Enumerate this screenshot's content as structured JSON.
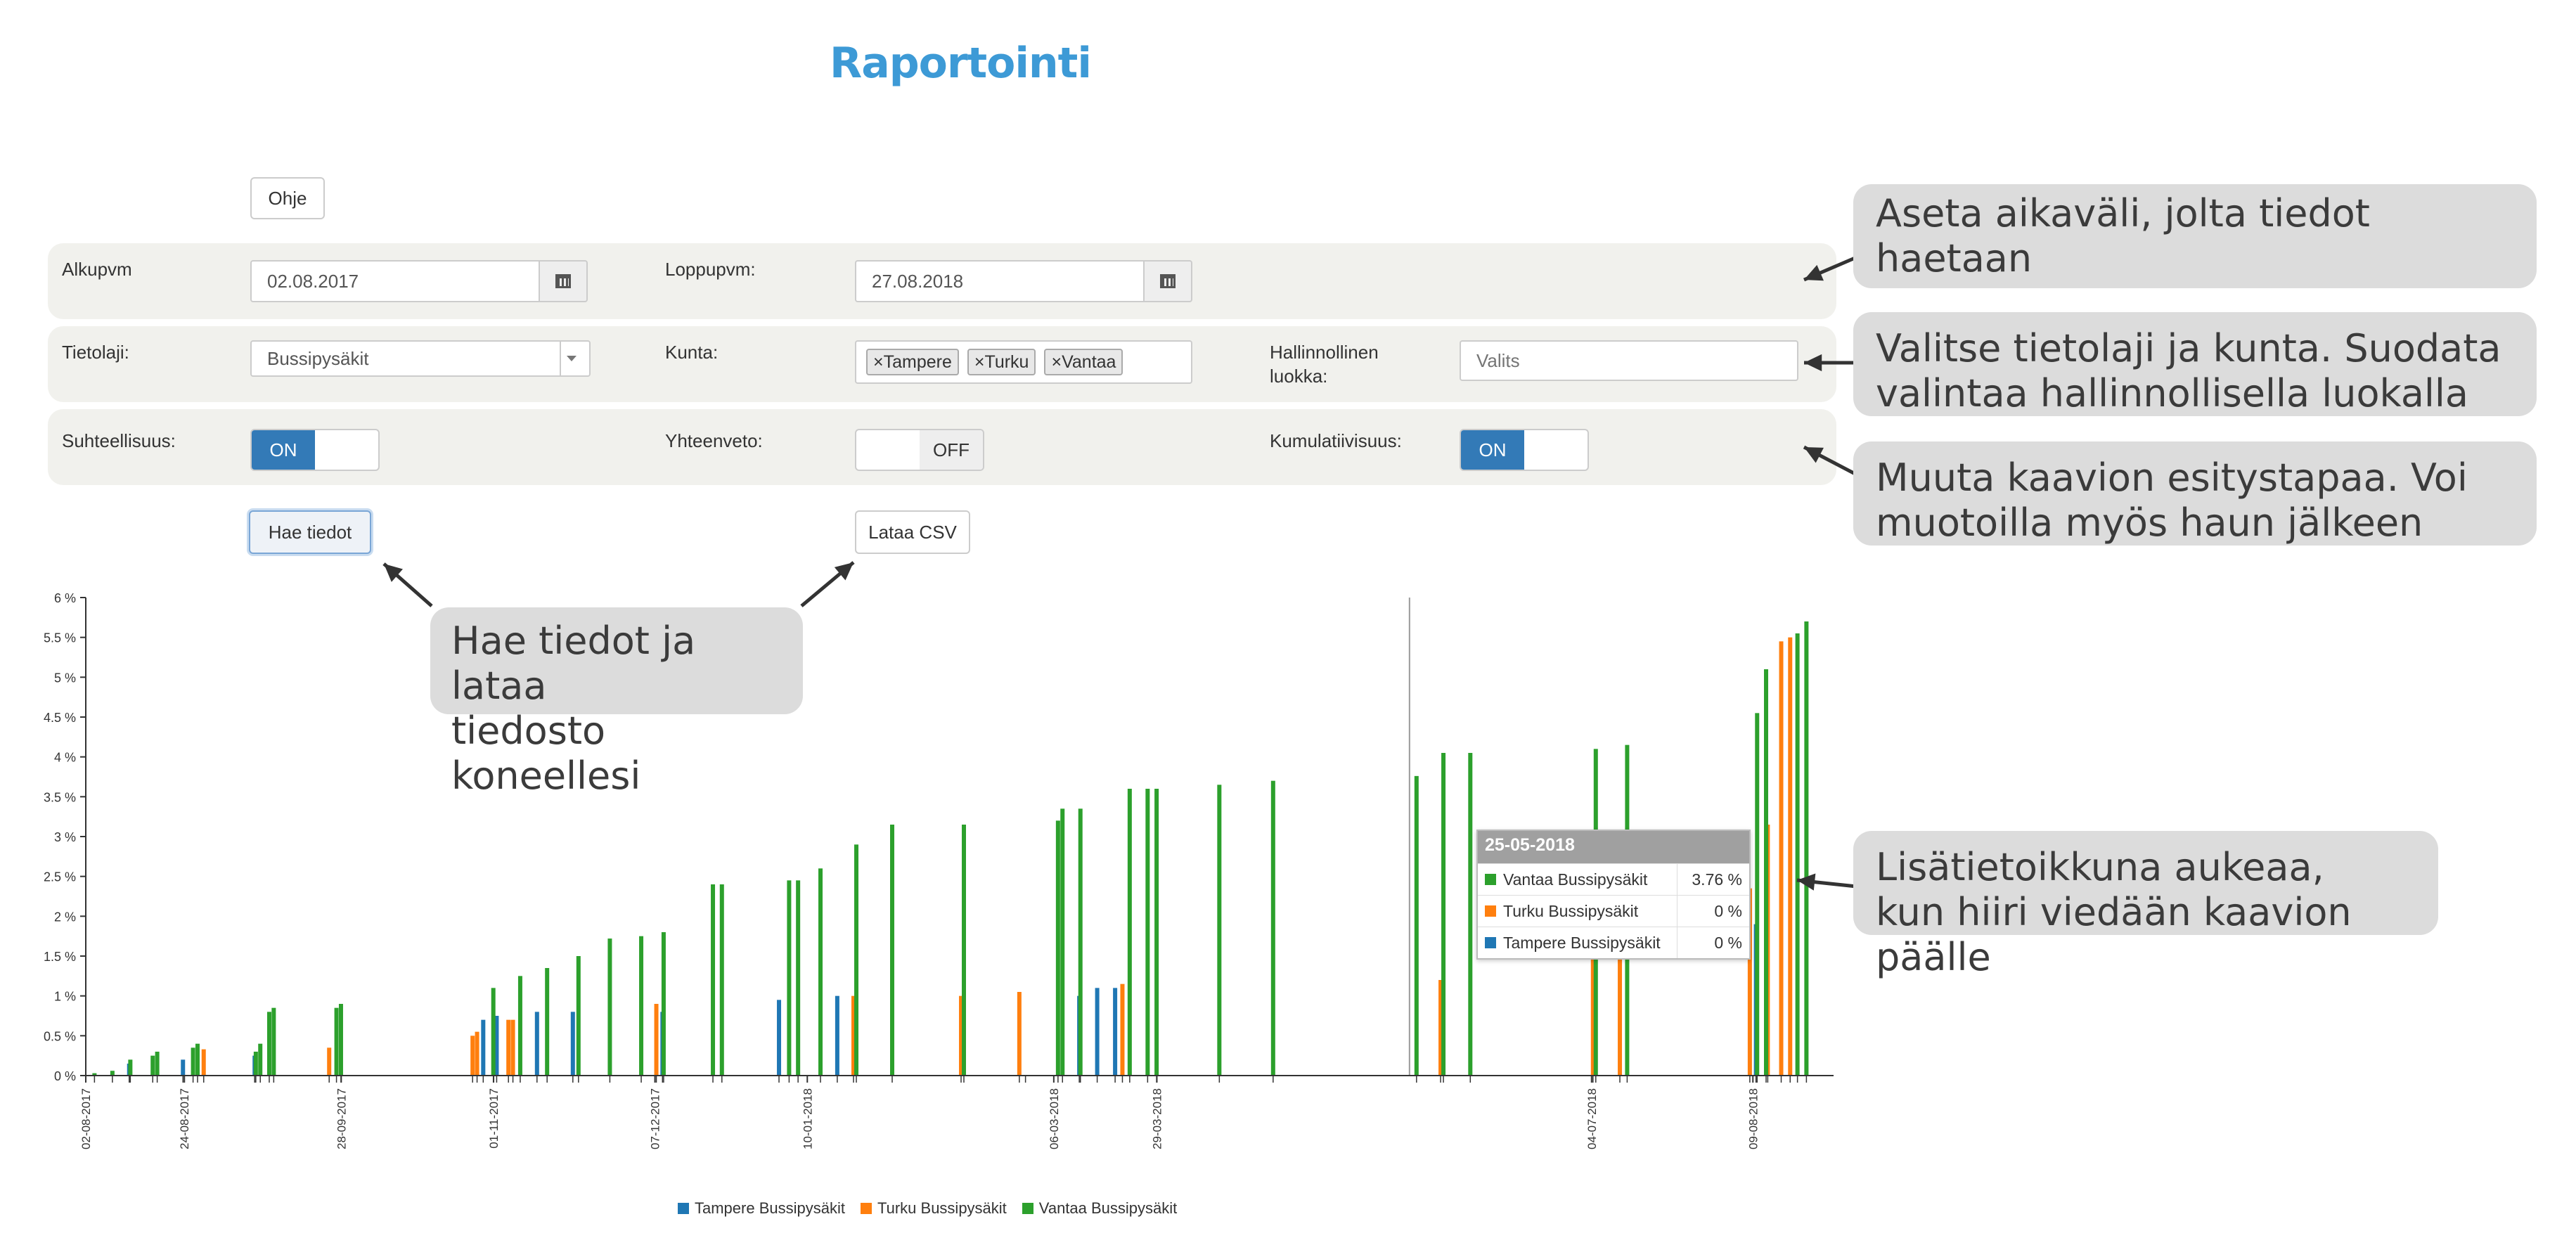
{
  "page": {
    "title": "Raportointi"
  },
  "help_button": "Ohje",
  "row1": {
    "start_label": "Alkupvm",
    "start_value": "02.08.2017",
    "end_label": "Loppupvm:",
    "end_value": "27.08.2018"
  },
  "row2": {
    "type_label": "Tietolaji:",
    "type_value": "Bussipysäkit",
    "municipality_label": "Kunta:",
    "municipality_tags": [
      {
        "label": "Tampere"
      },
      {
        "label": "Turku"
      },
      {
        "label": "Vantaa"
      }
    ],
    "admin_label_1": "Hallinnollinen",
    "admin_label_2": "luokka:",
    "admin_placeholder": "Valits"
  },
  "row3": {
    "relative_label": "Suhteellisuus:",
    "relative_state": "ON",
    "summary_label": "Yhteenveto:",
    "summary_state": "OFF",
    "cumulative_label": "Kumulatiivisuus:",
    "cumulative_state": "ON"
  },
  "actions": {
    "fetch": "Hae tiedot",
    "csv": "Lataa CSV"
  },
  "callouts": {
    "c1": "Aseta aikaväli, jolta tiedot haetaan",
    "c2a": "Valitse tietolaji ja kunta. Suodata",
    "c2b": "valintaa hallinnollisella luokalla",
    "c3a": "Muuta kaavion esitystapaa. Voi",
    "c3b": "muotoilla myös haun jälkeen",
    "c4a": "Hae tiedot ja lataa",
    "c4b": "tiedosto koneellesi",
    "c5a": "Lisätietoikkuna aukeaa,",
    "c5b": "kun hiiri viedään kaavion päälle"
  },
  "tooltip": {
    "date": "25-05-2018",
    "rows": [
      {
        "name": "Vantaa Bussipysäkit",
        "value": "3.76 %"
      },
      {
        "name": "Turku Bussipysäkit",
        "value": "0 %"
      },
      {
        "name": "Tampere Bussipysäkit",
        "value": "0 %"
      }
    ]
  },
  "colors": {
    "tampere": "#1f77b4",
    "turku": "#ff7f0e",
    "vantaa": "#2ca02c",
    "accent": "#337ab7"
  },
  "chart_data": {
    "type": "bar",
    "ylim": [
      0,
      6
    ],
    "yticks": [
      "0 %",
      "0.5 %",
      "1 %",
      "1.5 %",
      "2 %",
      "2.5 %",
      "3 %",
      "3.5 %",
      "4 %",
      "4.5 %",
      "5 %",
      "5.5 %",
      "6 %"
    ],
    "xlim": [
      "2017-08-02",
      "2018-08-27"
    ],
    "xticks": [
      "02-08-2017",
      "24-08-2017",
      "28-09-2017",
      "01-11-2017",
      "07-12-2017",
      "10-01-2018",
      "06-03-2018",
      "29-03-2018",
      "04-07-2018",
      "09-08-2018"
    ],
    "series": [
      {
        "name": "Tampere Bussipysäkit",
        "points": [
          [
            "2017-08-12",
            0.15
          ],
          [
            "2017-08-24",
            0.2
          ],
          [
            "2017-09-09",
            0.25
          ],
          [
            "2017-10-30",
            0.7
          ],
          [
            "2017-11-02",
            0.75
          ],
          [
            "2017-11-11",
            0.8
          ],
          [
            "2017-11-19",
            0.8
          ],
          [
            "2017-12-09",
            0.8
          ],
          [
            "2018-01-04",
            0.95
          ],
          [
            "2018-01-17",
            1.0
          ],
          [
            "2018-02-28",
            0.0
          ],
          [
            "2018-03-12",
            1.0
          ],
          [
            "2018-03-16",
            1.1
          ],
          [
            "2018-03-20",
            1.1
          ],
          [
            "2018-08-10",
            1.9
          ]
        ]
      },
      {
        "name": "Turku Bussipysäkit",
        "points": [
          [
            "2017-08-28",
            0.33
          ],
          [
            "2017-09-25",
            0.35
          ],
          [
            "2017-10-27",
            0.5
          ],
          [
            "2017-10-28",
            0.55
          ],
          [
            "2017-11-04",
            0.7
          ],
          [
            "2017-11-05",
            0.7
          ],
          [
            "2017-12-07",
            0.9
          ],
          [
            "2018-01-20",
            1.0
          ],
          [
            "2018-02-13",
            1.0
          ],
          [
            "2018-02-26",
            1.05
          ],
          [
            "2018-03-21",
            1.15
          ],
          [
            "2018-05-31",
            1.2
          ],
          [
            "2018-07-04",
            2.4
          ],
          [
            "2018-07-10",
            2.6
          ],
          [
            "2018-08-08",
            2.35
          ],
          [
            "2018-08-12",
            3.15
          ],
          [
            "2018-08-15",
            5.45
          ],
          [
            "2018-08-17",
            5.5
          ]
        ]
      },
      {
        "name": "Vantaa Bussipysäkit",
        "points": [
          [
            "2017-08-03",
            0.03
          ],
          [
            "2017-08-07",
            0.06
          ],
          [
            "2017-08-11",
            0.2
          ],
          [
            "2017-08-16",
            0.25
          ],
          [
            "2017-08-17",
            0.3
          ],
          [
            "2017-08-25",
            0.35
          ],
          [
            "2017-08-26",
            0.4
          ],
          [
            "2017-09-08",
            0.3
          ],
          [
            "2017-09-09",
            0.4
          ],
          [
            "2017-09-11",
            0.8
          ],
          [
            "2017-09-12",
            0.85
          ],
          [
            "2017-09-26",
            0.85
          ],
          [
            "2017-09-27",
            0.9
          ],
          [
            "2017-10-31",
            1.1
          ],
          [
            "2017-11-06",
            1.25
          ],
          [
            "2017-11-12",
            1.35
          ],
          [
            "2017-11-19",
            1.5
          ],
          [
            "2017-11-26",
            1.72
          ],
          [
            "2017-12-03",
            1.75
          ],
          [
            "2017-12-08",
            1.8
          ],
          [
            "2017-12-19",
            2.4
          ],
          [
            "2017-12-21",
            2.4
          ],
          [
            "2018-01-05",
            2.45
          ],
          [
            "2018-01-07",
            2.45
          ],
          [
            "2018-01-12",
            2.6
          ],
          [
            "2018-01-20",
            2.9
          ],
          [
            "2018-01-28",
            3.15
          ],
          [
            "2018-02-13",
            3.15
          ],
          [
            "2018-03-06",
            3.2
          ],
          [
            "2018-03-07",
            3.35
          ],
          [
            "2018-03-11",
            3.35
          ],
          [
            "2018-03-22",
            3.6
          ],
          [
            "2018-03-26",
            3.6
          ],
          [
            "2018-03-28",
            3.6
          ],
          [
            "2018-04-11",
            3.65
          ],
          [
            "2018-04-23",
            3.7
          ],
          [
            "2018-05-25",
            3.76
          ],
          [
            "2018-05-31",
            4.05
          ],
          [
            "2018-06-06",
            4.05
          ],
          [
            "2018-07-04",
            4.1
          ],
          [
            "2018-07-11",
            4.15
          ],
          [
            "2018-08-09",
            4.55
          ],
          [
            "2018-08-11",
            5.1
          ],
          [
            "2018-08-18",
            5.55
          ],
          [
            "2018-08-20",
            5.7
          ]
        ]
      }
    ]
  }
}
